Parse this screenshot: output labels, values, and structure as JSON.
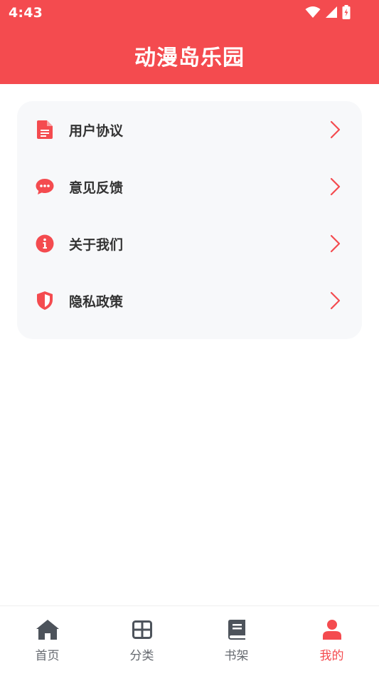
{
  "status_bar": {
    "time": "4:43",
    "icons": [
      "wifi-icon",
      "signal-icon",
      "battery-charging-icon"
    ]
  },
  "header": {
    "title": "动漫岛乐园",
    "background": "#f44b4f"
  },
  "menu": {
    "items": [
      {
        "label": "用户协议",
        "icon": "document-icon"
      },
      {
        "label": "意见反馈",
        "icon": "chat-bubble-icon"
      },
      {
        "label": "关于我们",
        "icon": "info-icon"
      },
      {
        "label": "隐私政策",
        "icon": "shield-icon"
      }
    ]
  },
  "tabbar": {
    "active": "我的",
    "accent": "#f44b4f",
    "tabs": [
      {
        "label": "首页",
        "icon": "home-icon"
      },
      {
        "label": "分类",
        "icon": "grid-icon"
      },
      {
        "label": "书架",
        "icon": "book-icon"
      },
      {
        "label": "我的",
        "icon": "user-icon"
      }
    ]
  }
}
